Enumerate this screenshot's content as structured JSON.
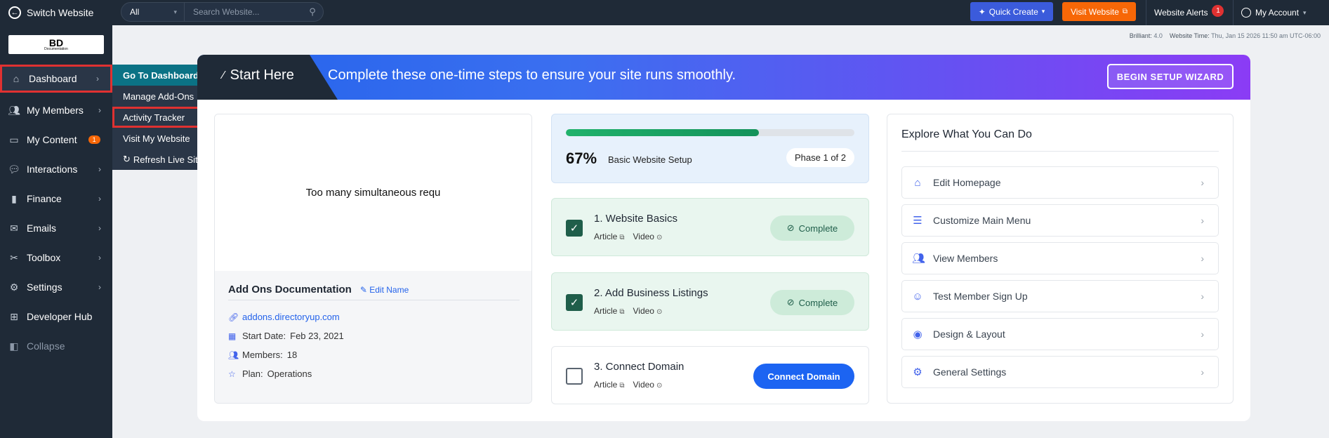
{
  "topbar": {
    "switch_label": "Switch Website",
    "search_scope": "All",
    "search_placeholder": "Search Website...",
    "quick_create": "Quick Create",
    "visit_website": "Visit Website",
    "alerts_label": "Website Alerts",
    "alerts_count": "1",
    "account_label": "My Account"
  },
  "sidebar": {
    "logo_text": "BD",
    "logo_sub": "Documentation",
    "items": [
      {
        "label": "Dashboard",
        "icon": "home-icon"
      },
      {
        "label": "My Members",
        "icon": "users-icon"
      },
      {
        "label": "My Content",
        "icon": "folder-icon",
        "badge": "1"
      },
      {
        "label": "Interactions",
        "icon": "chat-icon"
      },
      {
        "label": "Finance",
        "icon": "bar-chart-icon"
      },
      {
        "label": "Emails",
        "icon": "mail-icon"
      },
      {
        "label": "Toolbox",
        "icon": "tools-icon"
      },
      {
        "label": "Settings",
        "icon": "gear-icon"
      },
      {
        "label": "Developer Hub",
        "icon": "grid-icon"
      },
      {
        "label": "Collapse",
        "icon": "collapse-icon"
      }
    ]
  },
  "flyout": {
    "items": [
      "Go To Dashboard",
      "Manage Add-Ons",
      "Activity Tracker",
      "Visit My Website",
      "Refresh Live Site"
    ]
  },
  "header_info": {
    "brilliant_label": "Brilliant:",
    "brilliant_value": "4.0",
    "time_label": "Website Time:",
    "time_value": "Thu, Jan 15 2026 11:50 am UTC-06:00"
  },
  "banner": {
    "start_here": "Start Here",
    "message": "Complete these one-time steps to ensure your site runs smoothly.",
    "wizard_button": "BEGIN SETUP WIZARD"
  },
  "left_panel": {
    "preview_text": "Too many simultaneous requ",
    "title": "Add Ons Documentation",
    "edit_name": "Edit Name",
    "url": "addons.directoryup.com",
    "start_date_label": "Start Date:",
    "start_date": "Feb 23, 2021",
    "members_label": "Members:",
    "members": "18",
    "plan_label": "Plan:",
    "plan": "Operations"
  },
  "progress": {
    "fraction": 0.67,
    "percent": "67%",
    "label": "Basic Website Setup",
    "phase": "Phase 1 of 2"
  },
  "steps": [
    {
      "title": "1. Website Basics",
      "article": "Article",
      "video": "Video",
      "status": "Complete",
      "done": true
    },
    {
      "title": "2. Add Business Listings",
      "article": "Article",
      "video": "Video",
      "status": "Complete",
      "done": true
    },
    {
      "title": "3. Connect Domain",
      "article": "Article",
      "video": "Video",
      "action": "Connect Domain",
      "done": false
    }
  ],
  "explore": {
    "title": "Explore What You Can Do",
    "items": [
      {
        "label": "Edit Homepage",
        "icon": "home-icon"
      },
      {
        "label": "Customize Main Menu",
        "icon": "list-icon"
      },
      {
        "label": "View Members",
        "icon": "users-icon"
      },
      {
        "label": "Test Member Sign Up",
        "icon": "user-check-icon"
      },
      {
        "label": "Design & Layout",
        "icon": "palette-icon"
      },
      {
        "label": "General Settings",
        "icon": "gear-icon"
      }
    ]
  },
  "colors": {
    "sidebar_bg": "#1f2a37",
    "accent_blue": "#2463eb",
    "orange": "#f76707",
    "highlight_red": "#e03131",
    "complete_green": "#1f5e4a"
  }
}
